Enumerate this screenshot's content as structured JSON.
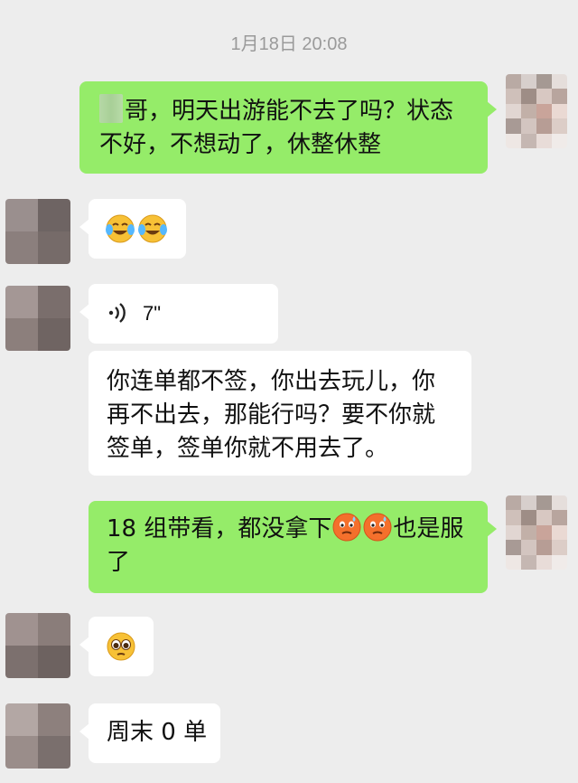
{
  "chat": {
    "timestamp": "1月18日 20:08",
    "messages": [
      {
        "sender": "me",
        "text_before_mask": "",
        "text": "哥，明天出游能不去了吗？状态不好，不想动了，休整休整"
      },
      {
        "sender": "other",
        "emojis": [
          "laugh-cry-emoji",
          "laugh-cry-emoji"
        ]
      },
      {
        "sender": "other",
        "type": "voice",
        "duration": "7\""
      },
      {
        "sender": "other",
        "text": "你连单都不签，你出去玩儿，你再不出去，那能行吗？要不你就签单，签单你就不用去了。"
      },
      {
        "sender": "me",
        "text_part1": "18 组带看，都没拿下",
        "emojis": [
          "sweat-emoji",
          "sweat-emoji"
        ],
        "text_part2": "也是服了"
      },
      {
        "sender": "other",
        "emojis": [
          "pleading-emoji"
        ]
      },
      {
        "sender": "other",
        "text": "周末 0 单"
      }
    ]
  },
  "colors": {
    "background": "#ededed",
    "my_bubble": "#95ec69",
    "their_bubble": "#ffffff",
    "timestamp_text": "#9a9a9a"
  },
  "icons": [
    "voice-wave-icon",
    "laugh-cry-emoji",
    "sweat-emoji",
    "pleading-emoji"
  ]
}
